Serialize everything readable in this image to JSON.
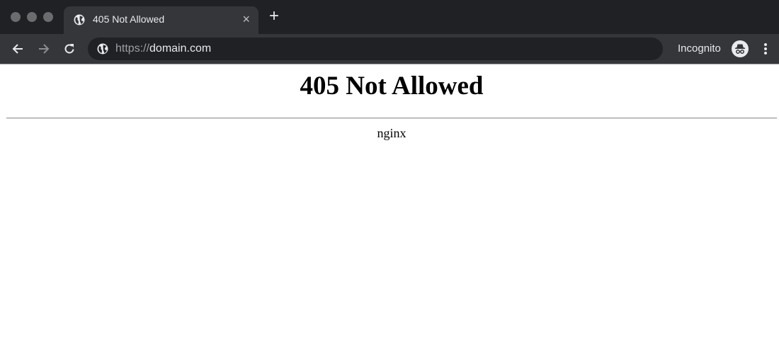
{
  "browser": {
    "tab": {
      "title": "405 Not Allowed",
      "favicon": "globe-icon",
      "close_glyph": "×"
    },
    "new_tab_glyph": "+",
    "nav": {
      "back_icon": "arrow-left-icon",
      "forward_icon": "arrow-right-icon",
      "reload_icon": "reload-icon"
    },
    "address": {
      "scheme": "https://",
      "host": "domain.com",
      "site_icon": "globe-icon"
    },
    "profile": {
      "label": "Incognito",
      "icon": "incognito-icon"
    },
    "menu_icon": "more-vertical-icon",
    "colors": {
      "tabstrip": "#202124",
      "toolbar": "#35363a",
      "text": "#e8eaed"
    }
  },
  "page": {
    "heading": "405 Not Allowed",
    "server": "nginx"
  }
}
